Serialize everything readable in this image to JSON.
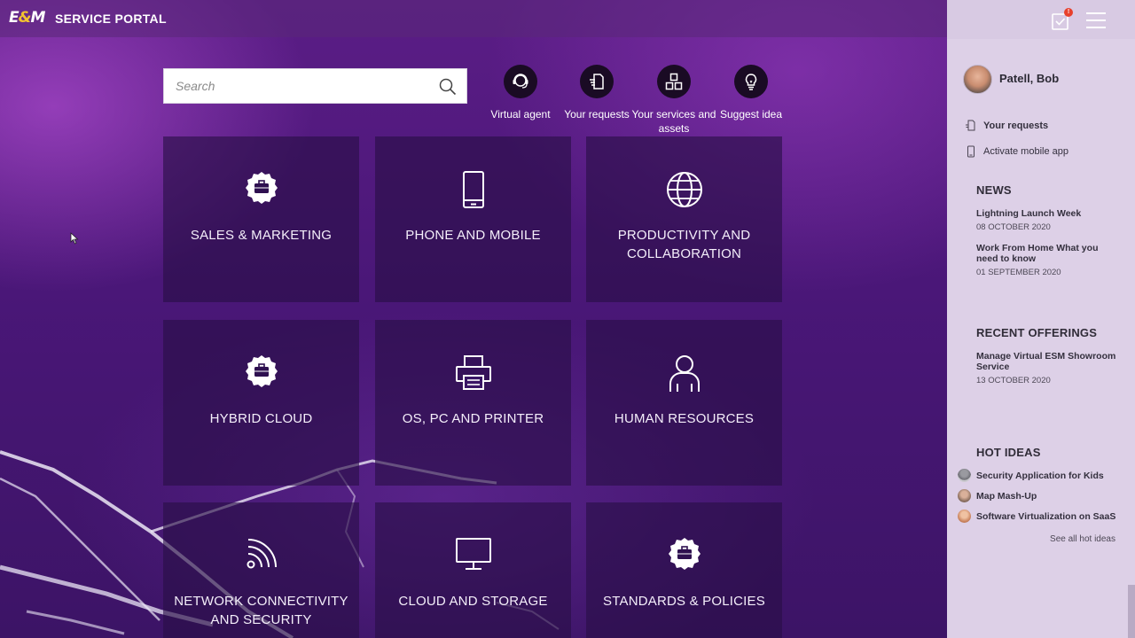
{
  "header": {
    "logo_prefix": "E",
    "logo_amp": "&",
    "logo_suffix": "M",
    "title": "SERVICE PORTAL",
    "notification_count": "!"
  },
  "search": {
    "placeholder": "Search"
  },
  "quick_actions": [
    {
      "label": "Virtual agent",
      "icon": "virtual-agent-icon"
    },
    {
      "label": "Your requests",
      "icon": "requests-icon"
    },
    {
      "label": "Your services and assets",
      "icon": "services-assets-icon"
    },
    {
      "label": "Suggest idea",
      "icon": "lightbulb-icon"
    }
  ],
  "tiles": [
    {
      "label": "SALES & MARKETING",
      "icon": "briefcase-badge-icon"
    },
    {
      "label": "PHONE AND MOBILE",
      "icon": "mobile-phone-icon"
    },
    {
      "label": "PRODUCTIVITY AND COLLABORATION",
      "icon": "globe-icon"
    },
    {
      "label": "HYBRID CLOUD",
      "icon": "briefcase-badge-icon"
    },
    {
      "label": "OS, PC AND PRINTER",
      "icon": "printer-icon"
    },
    {
      "label": "HUMAN RESOURCES",
      "icon": "person-icon"
    },
    {
      "label": "NETWORK CONNECTIVITY AND SECURITY",
      "icon": "wifi-icon"
    },
    {
      "label": "CLOUD AND STORAGE",
      "icon": "monitor-icon"
    },
    {
      "label": "STANDARDS & POLICIES",
      "icon": "briefcase-badge-icon"
    }
  ],
  "sidebar": {
    "user_name": "Patell, Bob",
    "links": [
      {
        "label": "Your requests",
        "icon": "requests-icon"
      },
      {
        "label": "Activate mobile app",
        "icon": "mobile-icon"
      }
    ],
    "news": {
      "heading": "NEWS",
      "items": [
        {
          "title": "Lightning Launch Week",
          "date": "08 OCTOBER 2020"
        },
        {
          "title": "Work From Home What you need to know",
          "date": "01 SEPTEMBER 2020"
        }
      ]
    },
    "recent_offerings": {
      "heading": "RECENT OFFERINGS",
      "items": [
        {
          "title": "Manage Virtual ESM Showroom Service",
          "date": "13 OCTOBER 2020"
        }
      ]
    },
    "hot_ideas": {
      "heading": "HOT IDEAS",
      "items": [
        {
          "title": "Security Application for Kids"
        },
        {
          "title": "Map Mash-Up"
        },
        {
          "title": "Software Virtualization on SaaS"
        }
      ],
      "see_all": "See all hot ideas"
    }
  },
  "colors": {
    "background": "#4a1778",
    "tile": "#28104a",
    "sidebar": "#ddd0e7",
    "notification_badge": "#e8402c",
    "logo_accent": "#f2c230"
  }
}
